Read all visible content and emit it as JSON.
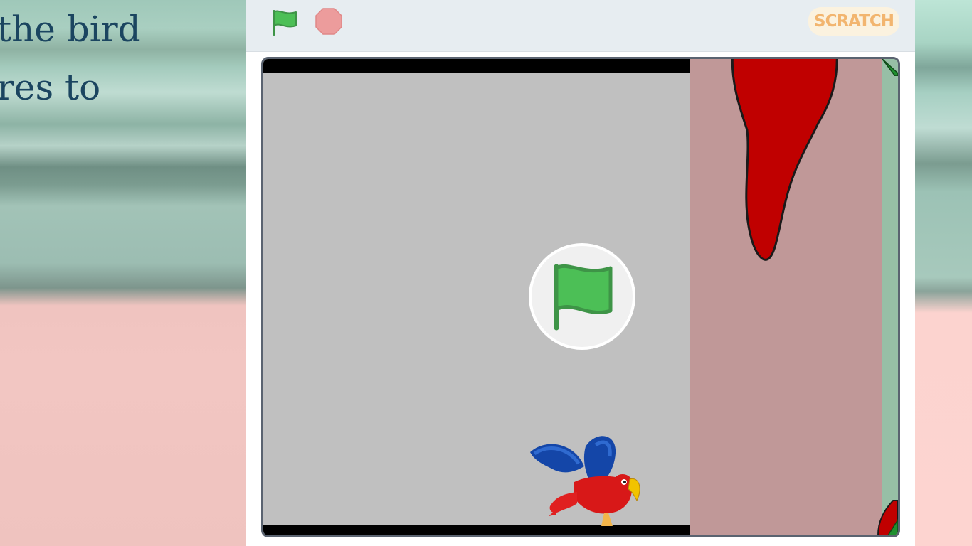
{
  "background": {
    "text_lines": [
      "the bird",
      "res to"
    ],
    "text_color": "#1b4560"
  },
  "player": {
    "toolbar": {
      "green_flag_icon": "green-flag-icon",
      "stop_icon": "stop-sign-icon",
      "logo_text": "SCRATCH"
    },
    "stage": {
      "play_overlay_icon": "green-flag-icon",
      "sprites": [
        "bird",
        "red-stalactite-pipe"
      ]
    },
    "colors": {
      "flag_green": "#4cbf56",
      "stop_red": "#ec9c9c",
      "logo_orange": "#f2b56f",
      "stage_gray": "#c0c0c0",
      "pipe_bg": "#c09898",
      "pipe_red": "#c00000"
    }
  }
}
